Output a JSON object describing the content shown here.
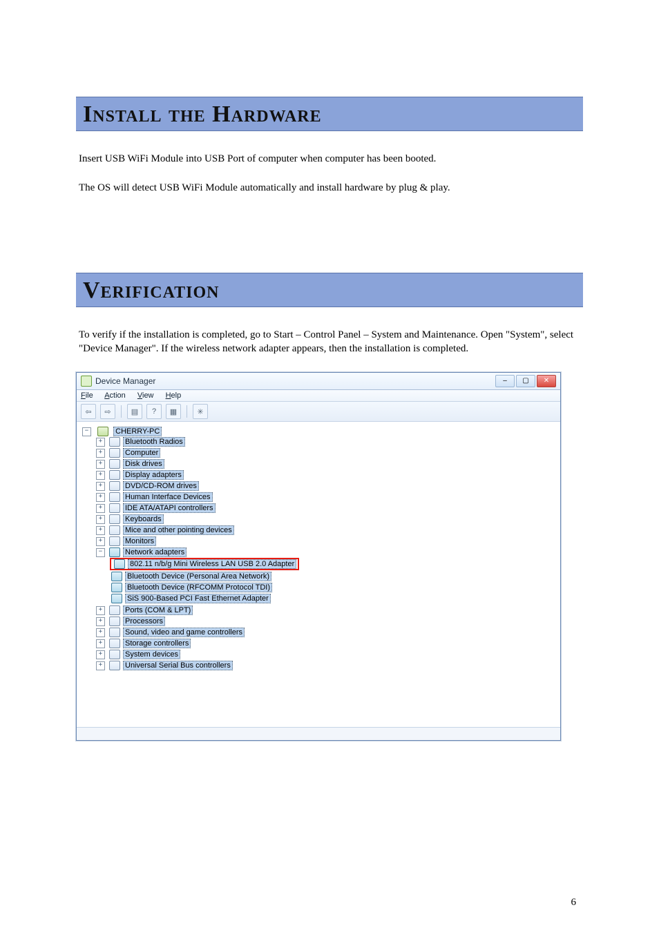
{
  "headings": {
    "install": "Install the Hardware",
    "verification": "Verification"
  },
  "paragraphs": {
    "install_p1": "Insert USB WiFi Module into USB Port of computer when computer has been booted.",
    "install_p2": "The OS will detect USB WiFi Module automatically and install hardware by plug & play.",
    "verif_p1": "To verify if the installation is completed, go to Start – Control Panel – System and Maintenance. Open \"System\", select \"Device Manager\". If the wireless network adapter appears, then the installation is completed."
  },
  "window": {
    "title": "Device Manager",
    "menus": {
      "file": "File",
      "action": "Action",
      "view": "View",
      "help": "Help"
    },
    "winbuttons": {
      "min": "–",
      "max": "▢",
      "close": "✕"
    },
    "toolbar": {
      "back": "⇦",
      "fwd": "⇨",
      "b1": "▤",
      "b2": "?",
      "b3": "▦",
      "b4": "✳"
    },
    "root": "CHERRY-PC",
    "nodes": {
      "bt": "Bluetooth Radios",
      "comp": "Computer",
      "disk": "Disk drives",
      "disp": "Display adapters",
      "dvd": "DVD/CD-ROM drives",
      "hid": "Human Interface Devices",
      "ide": "IDE ATA/ATAPI controllers",
      "kbd": "Keyboards",
      "mice": "Mice and other pointing devices",
      "mon": "Monitors",
      "net": "Network adapters",
      "ports": "Ports (COM & LPT)",
      "proc": "Processors",
      "sound": "Sound, video and game controllers",
      "stor": "Storage controllers",
      "sys": "System devices",
      "usb": "Universal Serial Bus controllers"
    },
    "net_children": {
      "a": "802.11 n/b/g Mini Wireless LAN USB 2.0 Adapter",
      "b": "Bluetooth Device (Personal Area Network)",
      "c": "Bluetooth Device (RFCOMM Protocol TDI)",
      "d": "SiS 900-Based PCI Fast Ethernet Adapter"
    }
  },
  "pagenum": "6"
}
